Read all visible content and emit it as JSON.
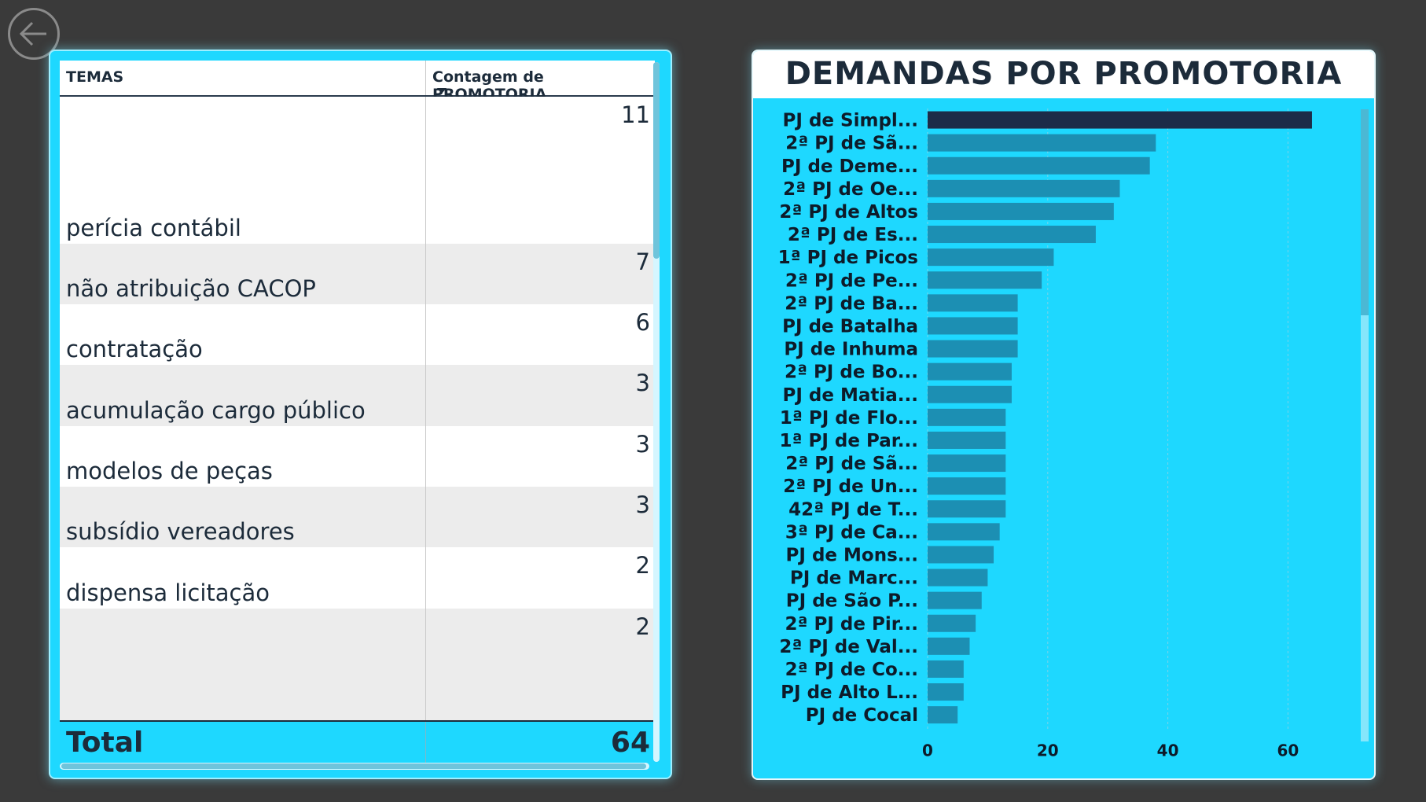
{
  "nav": {
    "back_icon": "back-arrow-icon"
  },
  "table": {
    "headers": {
      "temas": "TEMAS",
      "count": "Contagem de PROMOTORIA"
    },
    "rows": [
      {
        "label": "perícia contábil",
        "count": "11"
      },
      {
        "label": "não atribuição CACOP",
        "count": "7"
      },
      {
        "label": "contratação",
        "count": "6"
      },
      {
        "label": "acumulação cargo público",
        "count": "3"
      },
      {
        "label": "modelos de peças",
        "count": "3"
      },
      {
        "label": "subsídio vereadores",
        "count": "3"
      },
      {
        "label": "dispensa licitação",
        "count": "2"
      },
      {
        "label": "",
        "count": "2"
      }
    ],
    "total_label": "Total",
    "total_value": "64"
  },
  "chart_data": {
    "type": "bar",
    "orientation": "horizontal",
    "title": "DEMANDAS POR PROMOTORIA",
    "xlabel": "",
    "ylabel": "",
    "categories": [
      "PJ de Simpl...",
      "2ª PJ de Sã...",
      "PJ de Deme...",
      "2ª PJ de Oe...",
      "2ª PJ de Altos",
      "2ª PJ de Es...",
      "1ª PJ de Picos",
      "2ª PJ de Pe...",
      "2ª PJ de Ba...",
      "PJ de Batalha",
      "PJ de Inhuma",
      "2ª PJ de Bo...",
      "PJ de Matia...",
      "1ª PJ de Flo...",
      "1ª PJ de Par...",
      "2ª PJ de Sã...",
      "2ª PJ de Un...",
      "42ª PJ de T...",
      "3ª PJ de Ca...",
      "PJ de Mons...",
      "PJ de Marc...",
      "PJ de São P...",
      "2ª PJ de Pir...",
      "2ª PJ de Val...",
      "2ª PJ de Co...",
      "PJ de Alto L...",
      "PJ de Cocal"
    ],
    "values": [
      64,
      38,
      37,
      32,
      31,
      28,
      21,
      19,
      15,
      15,
      15,
      14,
      14,
      13,
      13,
      13,
      13,
      13,
      12,
      11,
      10,
      9,
      8,
      7,
      6,
      6,
      5
    ],
    "xlim": [
      0,
      70
    ],
    "xticks": [
      0,
      20,
      40,
      60
    ],
    "highlight_index": 0,
    "colors": {
      "bar": "#1c8fb3",
      "highlight": "#1c2b48",
      "label": "#0d1b2a",
      "grid": "#7ad3ea"
    }
  }
}
